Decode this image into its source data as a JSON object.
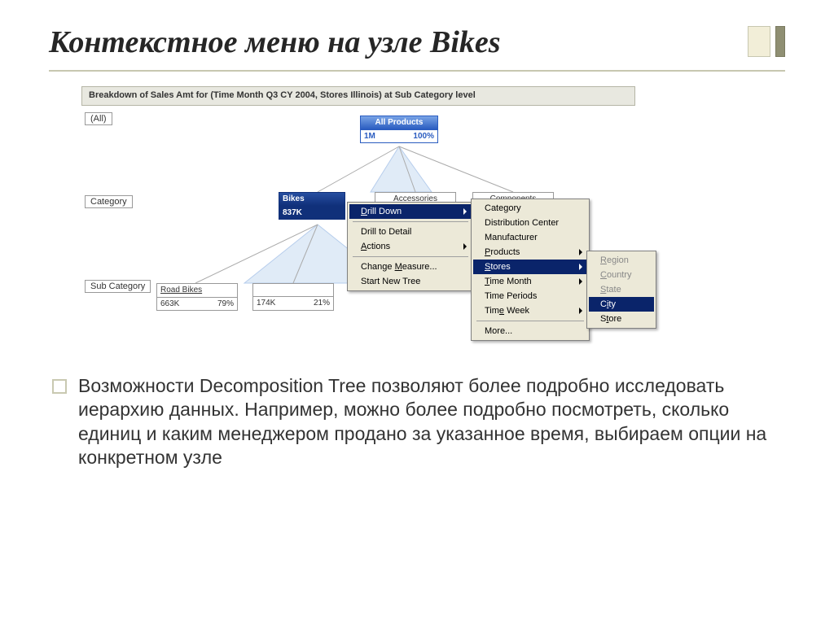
{
  "slide": {
    "title": "Контекстное меню на узле Bikes"
  },
  "shot": {
    "header": "Breakdown of Sales Amt for (Time Month Q3 CY  2004, Stores Illinois) at Sub Category level",
    "rowLabels": {
      "all": "(All)",
      "category": "Category",
      "subCategory": "Sub Category"
    },
    "nodes": {
      "all": {
        "label": "All Products",
        "val": "1M",
        "pct": "100%"
      },
      "bikes": {
        "label": "Bikes",
        "val": "837K",
        "pct": ""
      },
      "accessories": {
        "label": "Accessories"
      },
      "components": {
        "label": "Components"
      },
      "road": {
        "label": "Road Bikes",
        "val": "663K",
        "pct": "79%"
      },
      "sub2": {
        "label": "",
        "val": "174K",
        "pct": "21%"
      }
    }
  },
  "menus": {
    "main": {
      "drillDown": "Drill Down",
      "drillDetail": "Drill to Detail",
      "actions": "Actions",
      "changeMeasure": "Change Measure...",
      "startNewTree": "Start New Tree"
    },
    "sub1": {
      "category": "Category",
      "distribution": "Distribution Center",
      "manufacturer": "Manufacturer",
      "products": "Products",
      "stores": "Stores",
      "timeMonth": "Time Month",
      "timePeriods": "Time Periods",
      "timeWeek": "Time Week",
      "more": "More..."
    },
    "sub2": {
      "region": "Region",
      "country": "Country",
      "state": "State",
      "city": "City",
      "store": "Store"
    }
  },
  "body": {
    "text": "Возможности Decomposition Tree позволяют более подробно исследовать иерархию данных. Например, можно более подробно посмотреть, сколько единиц и каким менеджером продано за указанное время, выбираем опции на конкретном узле"
  }
}
